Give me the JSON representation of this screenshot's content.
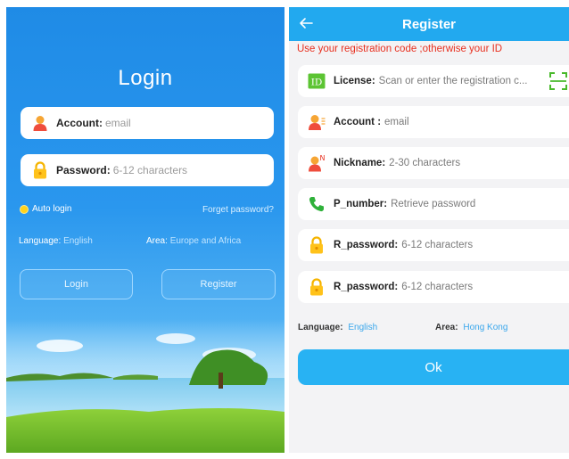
{
  "login": {
    "title": "Login",
    "account": {
      "label": "Account:",
      "placeholder": "email"
    },
    "password": {
      "label": "Password:",
      "placeholder": "6-12 characters"
    },
    "auto_login": "Auto login",
    "forget_password": "Forget password?",
    "language_label": "Language:",
    "language_value": "English",
    "area_label": "Area:",
    "area_value": "Europe and Africa",
    "login_button": "Login",
    "register_button": "Register"
  },
  "register": {
    "title": "Register",
    "back_icon": "arrow-left-icon",
    "hint": "Use your registration code ;otherwise your ID",
    "fields": [
      {
        "icon": "id-card-icon",
        "label": "License:",
        "placeholder": "Scan or enter the registration c..."
      },
      {
        "icon": "user-icon",
        "label": "Account :",
        "placeholder": "email"
      },
      {
        "icon": "user-n-icon",
        "label": "Nickname:",
        "placeholder": "2-30 characters"
      },
      {
        "icon": "phone-icon",
        "label": "P_number:",
        "placeholder": "Retrieve password"
      },
      {
        "icon": "lock-icon",
        "label": "R_password:",
        "placeholder": "6-12 characters"
      },
      {
        "icon": "lock-icon",
        "label": "R_password:",
        "placeholder": "6-12 characters"
      }
    ],
    "scan_icon": "scan-icon",
    "language_label": "Language:",
    "language_value": "English",
    "area_label": "Area:",
    "area_value": "Hong Kong",
    "ok_button": "Ok"
  },
  "colors": {
    "login_bg": "#2a97ee",
    "header": "#22a9ef",
    "hint": "#e8301f",
    "accent_link": "#3aa7ec",
    "ok_button": "#28b2f3"
  }
}
